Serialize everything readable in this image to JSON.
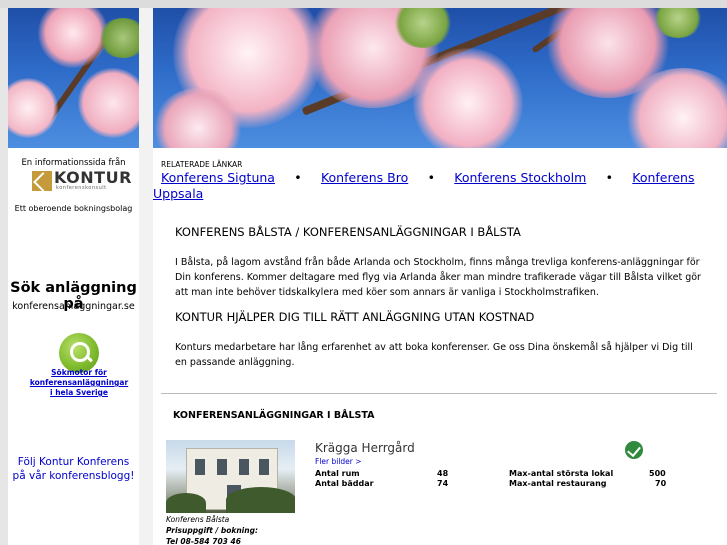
{
  "sidebar": {
    "info_from": "En informationssida från",
    "logo_text": "KONTUR",
    "logo_sub": "konferenskonsult",
    "independent": "Ett oberoende bokningsbolag",
    "search_heading": "Sök anläggning på",
    "search_site": "konferensanläggningar.se",
    "search_link_lines": [
      "Sökmotor för",
      "konferensanläggningar",
      "i hela Sverige"
    ],
    "blog_lines": [
      "Följ Kontur Konferens",
      "på vår konferensblogg!"
    ],
    "search_icon": "magnifier-icon"
  },
  "related": {
    "title": "RELATERADE LÄNKAR",
    "links": [
      "Konferens Sigtuna",
      "Konferens Bro",
      "Konferens Stockholm",
      "Konferens Uppsala"
    ],
    "bullet": "•"
  },
  "content": {
    "heading1": "KONFERENS BÅLSTA / KONFERENSANLÄGGNINGAR I BÅLSTA",
    "para1": "I Bålsta, på lagom avstånd från både Arlanda och Stockholm, finns många trevliga konferens-anläggningar för Din konferens. Kommer deltagare med flyg via Arlanda åker man mindre trafikerade vägar till Bålsta vilket gör att man inte behöver tidskalkylera med köer som annars är vanliga i Stockholmstrafiken.",
    "heading2": "KONTUR HJÄLPER DIG TILL RÄTT ANLÄGGNING UTAN KOSTNAD",
    "para2": "Konturs medarbetare har lång erfarenhet av att boka konferenser. Ge oss Dina önskemål så hjälper vi Dig till en passande anläggning.",
    "list_heading": "KONFERENSANLÄGGNINGAR I BÅLSTA"
  },
  "venue": {
    "name": "Krägga Herrgård",
    "more_pictures": "Fler bilder >",
    "caption_place": "Konferens Bålsta",
    "caption_price": "Prisuppgift / bokning:",
    "caption_phone": "Tel  08-584 703 46",
    "eco_icon": "swan-ecolabel-icon",
    "stats": {
      "rooms_label": "Antal rum",
      "rooms_value": "48",
      "beds_label": "Antal bäddar",
      "beds_value": "74",
      "max_room_label": "Max-antal största lokal",
      "max_room_value": "500",
      "max_rest_label": "Max-antal restaurang",
      "max_rest_value": "70"
    }
  }
}
